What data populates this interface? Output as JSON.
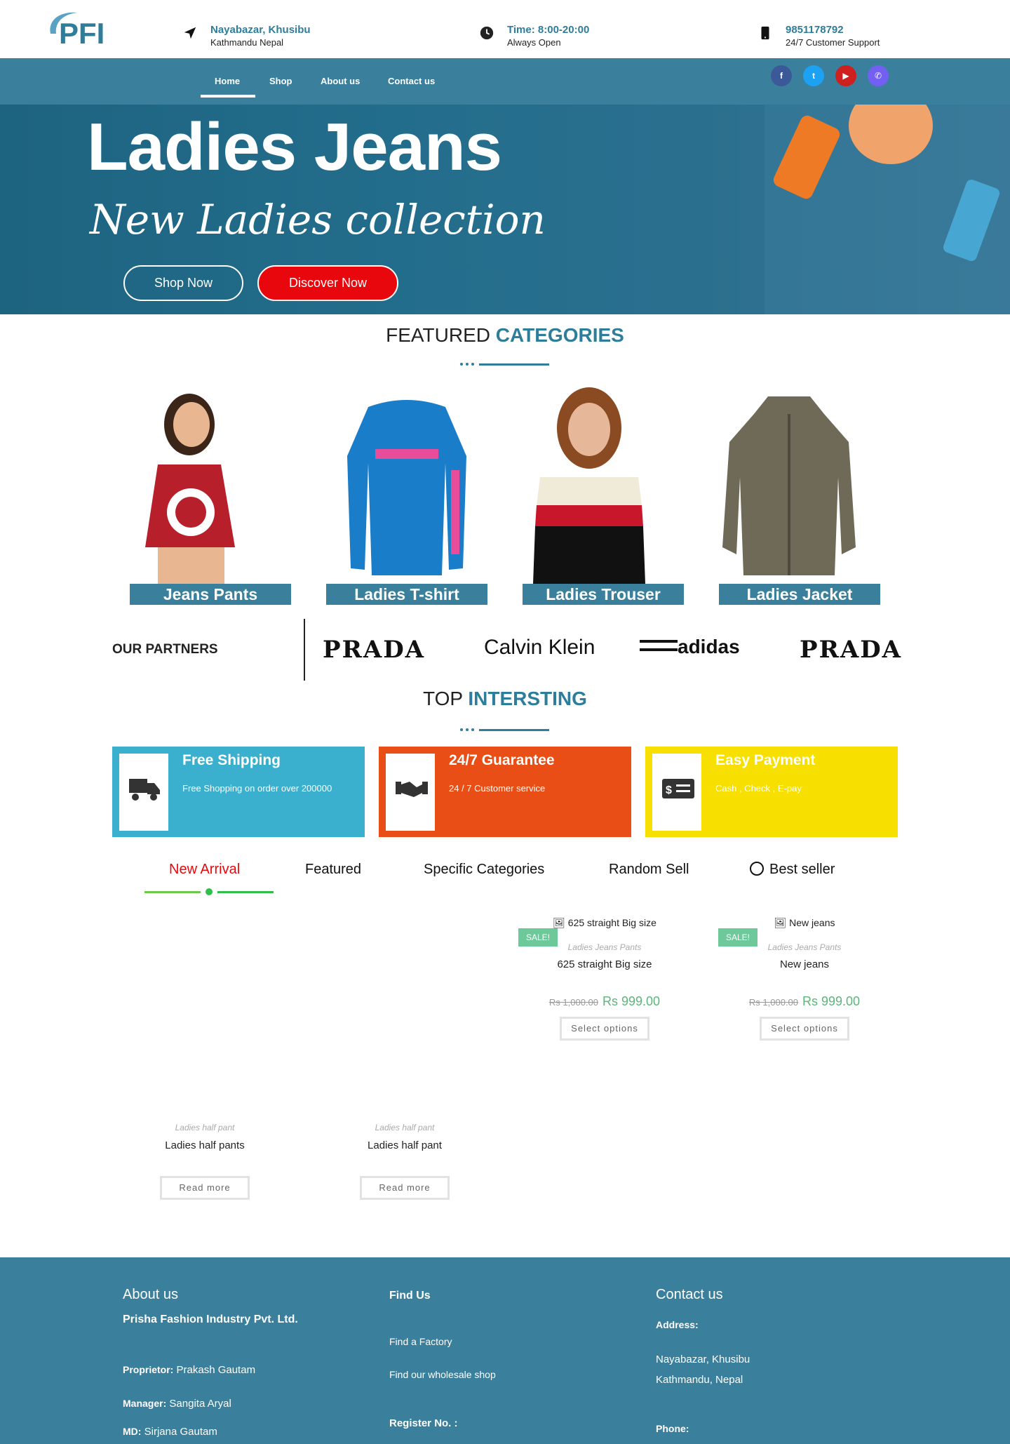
{
  "header": {
    "logo_text": "PFI",
    "location": {
      "line1": "Nayabazar, Khusibu",
      "line2": "Kathmandu Nepal"
    },
    "time": {
      "line1": "Time: 8:00-20:00",
      "line2": "Always Open"
    },
    "phone": {
      "line1": "9851178792",
      "line2": "24/7 Customer Support"
    }
  },
  "nav": {
    "items": [
      "Home",
      "Shop",
      "About us",
      "Contact us"
    ],
    "social": [
      "facebook-icon",
      "twitter-icon",
      "youtube-icon",
      "viber-icon"
    ]
  },
  "hero": {
    "title": "Ladies Jeans",
    "subtitle": "New Ladies collection",
    "shop_btn": "Shop Now",
    "discover_btn": "Discover Now"
  },
  "featured": {
    "title_plain": "FEATURED",
    "title_accent": "CATEGORIES",
    "categories": [
      "Jeans Pants",
      "Ladies T-shirt",
      "Ladies Trouser",
      "Ladies Jacket"
    ]
  },
  "partners": {
    "label": "OUR PARTNERS",
    "brands": [
      "PRADA",
      "Calvin Klein",
      "adidas",
      "PRADA"
    ]
  },
  "top": {
    "title_plain": "TOP",
    "title_accent": "INTERSTING",
    "features": [
      {
        "title": "Free Shipping",
        "sub": "Free Shopping  on order over 200000",
        "color": "#3ab0ce"
      },
      {
        "title": "24/7 Guarantee",
        "sub": "24 / 7 Customer service",
        "color": "#e84e16"
      },
      {
        "title": "Easy Payment",
        "sub": "Cash , Check , E-pay",
        "color": "#f7df00"
      }
    ]
  },
  "tabs": [
    "New Arrival",
    "Featured",
    "Specific Categories",
    "Random Sell",
    "Best seller"
  ],
  "products": [
    {
      "img_alt": "625 straight Big size",
      "sale": "SALE!",
      "category": "Ladies Jeans Pants",
      "name": "625 straight Big size",
      "old_price": "Rs 1,000.00",
      "price": "Rs 999.00",
      "btn": "Select options"
    },
    {
      "img_alt": "New jeans",
      "sale": "SALE!",
      "category": "Ladies Jeans Pants",
      "name": "New jeans",
      "old_price": "Rs 1,000.00",
      "price": "Rs 999.00",
      "btn": "Select options"
    },
    {
      "category": "Ladies half pant",
      "name": "Ladies half pants",
      "btn": "Read more"
    },
    {
      "category": "Ladies half pant",
      "name": "Ladies half pant",
      "btn": "Read more"
    }
  ],
  "footer": {
    "about": {
      "title": "About us",
      "company": "Prisha Fashion Industry Pvt. Ltd.",
      "proprietor_label": "Proprietor:",
      "proprietor": "Prakash Gautam",
      "manager_label": "Manager:",
      "manager": "Sangita Aryal",
      "md_label": "MD:",
      "md": "Sirjana Gautam"
    },
    "find": {
      "title": "Find Us",
      "link1": "Find a Factory",
      "link2": "Find our wholesale shop",
      "register": "Register No. :"
    },
    "contact": {
      "title": "Contact us",
      "address_label": "Address:",
      "address1": "Nayabazar, Khusibu",
      "address2": "Kathmandu, Nepal",
      "phone_label": "Phone:"
    }
  }
}
